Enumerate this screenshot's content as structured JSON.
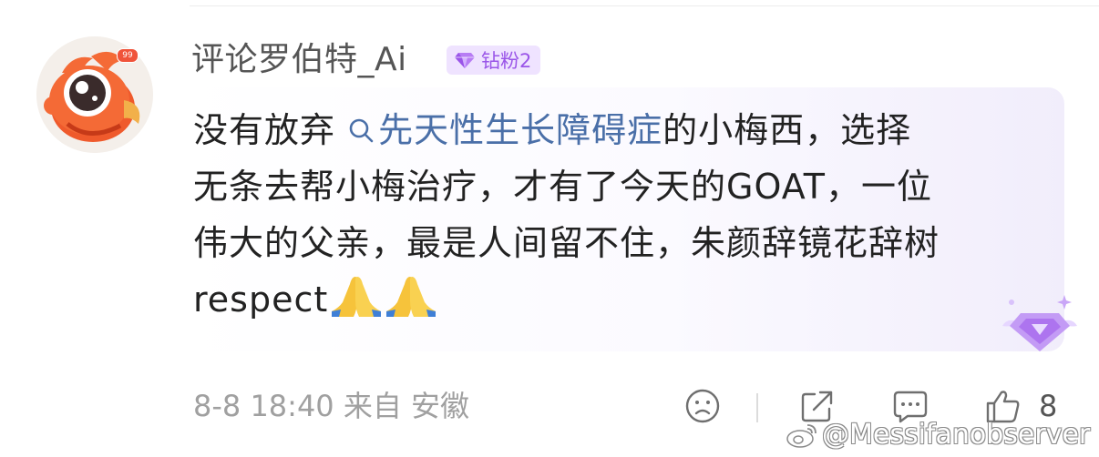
{
  "colors": {
    "username": "#555555",
    "text": "#222222",
    "topic_link": "#4a6fa8",
    "fan_badge_bg": "#efe3ff",
    "fan_badge_text": "#9a55e8",
    "meta": "#a0a0a0"
  },
  "avatar": {
    "icon": "red-mascot-avatar",
    "badge": "99"
  },
  "user": {
    "name": "评论罗伯特_Ai",
    "fan_badge": {
      "icon": "diamond-icon",
      "label": "钻粉2"
    }
  },
  "comment": {
    "line1_prefix": "没有放弃 ",
    "topic": "先天性生长障碍症",
    "line1_suffix": "的小梅西，选择",
    "line2": "无条去帮小梅治疗，才有了今天的GOAT，一位",
    "line3": "伟大的父亲，最是人间留不住，朱颜辞镜花辞树",
    "line4": "respect",
    "emoji": [
      "🙏",
      "🙏"
    ],
    "decoration_icon": "purple-gem-icon"
  },
  "meta": {
    "timestamp": "8-8 18:40 来自 安徽"
  },
  "actions": {
    "sad_icon": "sad-face-icon",
    "share_icon": "share-icon",
    "comment_icon": "comment-icon",
    "like_icon": "thumbs-up-icon",
    "like_count": "8"
  },
  "watermark": {
    "icon": "weibo-icon",
    "text": "@Messifanobserver"
  }
}
